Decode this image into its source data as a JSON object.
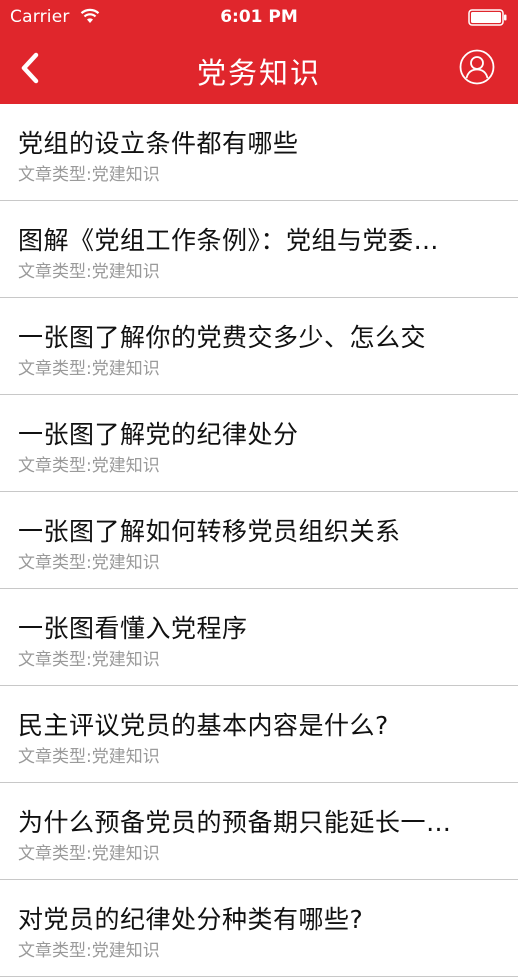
{
  "status_bar": {
    "carrier": "Carrier",
    "time": "6:01 PM"
  },
  "nav": {
    "title": "党务知识",
    "back_icon": "chevron-left-icon",
    "profile_icon": "user-circle-icon"
  },
  "colors": {
    "nav_background": "#e0262c",
    "title_text": "#111111",
    "subtitle_text": "#9a9a9a",
    "separator": "#c8c8c8"
  },
  "articles": [
    {
      "title": "党组的设立条件都有哪些",
      "type": "文章类型:党建知识"
    },
    {
      "title": "图解《党组工作条例》：党组与党委…",
      "type": "文章类型:党建知识"
    },
    {
      "title": "一张图了解你的党费交多少、怎么交",
      "type": "文章类型:党建知识"
    },
    {
      "title": "一张图了解党的纪律处分",
      "type": "文章类型:党建知识"
    },
    {
      "title": "一张图了解如何转移党员组织关系",
      "type": "文章类型:党建知识"
    },
    {
      "title": "一张图看懂入党程序",
      "type": "文章类型:党建知识"
    },
    {
      "title": "民主评议党员的基本内容是什么?",
      "type": "文章类型:党建知识"
    },
    {
      "title": "为什么预备党员的预备期只能延长一…",
      "type": "文章类型:党建知识"
    },
    {
      "title": "对党员的纪律处分种类有哪些?",
      "type": "文章类型:党建知识"
    }
  ]
}
